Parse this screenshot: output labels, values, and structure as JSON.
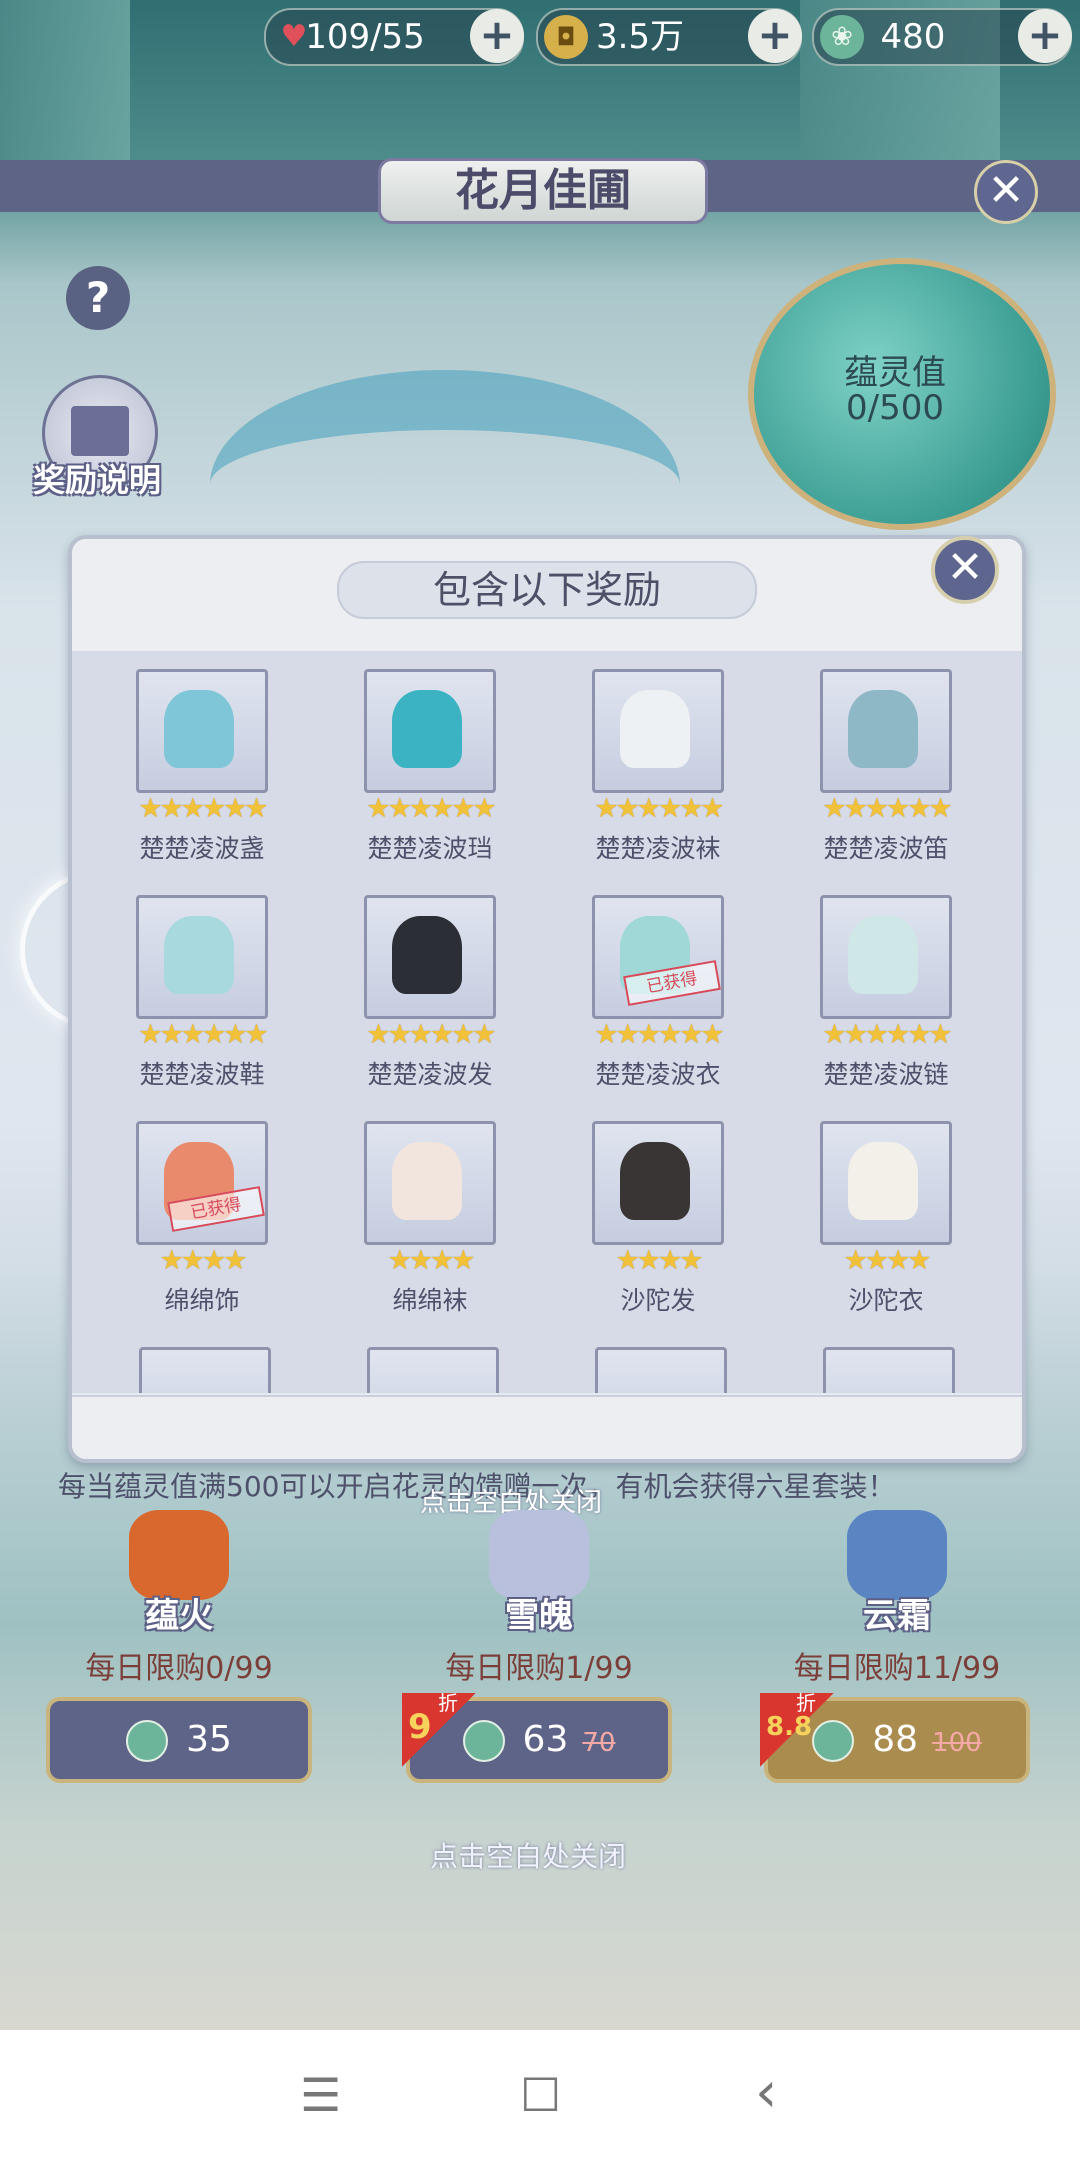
{
  "resources": [
    {
      "icon": "heart-icon",
      "value": "109/55"
    },
    {
      "icon": "coin-icon",
      "value": "3.5万"
    },
    {
      "icon": "jade-icon",
      "value": "480"
    }
  ],
  "title": "花月佳圃",
  "help_label": "?",
  "reward_info_label": "奖励说明",
  "gauge": {
    "label": "蕴灵值",
    "value": "0/500"
  },
  "modal": {
    "title": "包含以下奖励",
    "items": [
      {
        "name": "楚楚凌波盏",
        "stars": "★★★★★★",
        "owned": false,
        "color": "#7fc6d8"
      },
      {
        "name": "楚楚凌波珰",
        "stars": "★★★★★★",
        "owned": false,
        "color": "#3cb3c3"
      },
      {
        "name": "楚楚凌波袜",
        "stars": "★★★★★★",
        "owned": false,
        "color": "#eef1f4"
      },
      {
        "name": "楚楚凌波笛",
        "stars": "★★★★★★",
        "owned": false,
        "color": "#8fb8c6"
      },
      {
        "name": "楚楚凌波鞋",
        "stars": "★★★★★★",
        "owned": false,
        "color": "#a7d9de"
      },
      {
        "name": "楚楚凌波发",
        "stars": "★★★★★★",
        "owned": false,
        "color": "#2c2e36"
      },
      {
        "name": "楚楚凌波衣",
        "stars": "★★★★★★",
        "owned": true,
        "color": "#9fd8d6"
      },
      {
        "name": "楚楚凌波链",
        "stars": "★★★★★★",
        "owned": false,
        "color": "#cfe7e7"
      },
      {
        "name": "绵绵饰",
        "stars": "★★★★",
        "owned": true,
        "color": "#e98a6d"
      },
      {
        "name": "绵绵袜",
        "stars": "★★★★",
        "owned": false,
        "color": "#f1e5de"
      },
      {
        "name": "沙陀发",
        "stars": "★★★★",
        "owned": false,
        "color": "#3a3535"
      },
      {
        "name": "沙陀衣",
        "stars": "★★★★",
        "owned": false,
        "color": "#f3efe9"
      }
    ],
    "stamp_text": "已获得"
  },
  "description": "每当蕴灵值满500可以开启花灵的馈赠一次，有机会获得六星套装！",
  "close_hint": "点击空白处关闭",
  "shop": [
    {
      "name": "蕴火",
      "limit": "每日限购0/99",
      "price": "35",
      "old_price": "",
      "discount": "",
      "color": "#d9682e"
    },
    {
      "name": "雪魄",
      "limit": "每日限购1/99",
      "price": "63",
      "old_price": "70",
      "discount": "9",
      "color": "#b9c0dd"
    },
    {
      "name": "云霜",
      "limit": "每日限购11/99",
      "price": "88",
      "old_price": "100",
      "discount": "8.8",
      "color": "#5a84c2"
    }
  ],
  "discount_char": "折",
  "navbar": {
    "menu": "☰",
    "home": "☐",
    "back": "‹"
  }
}
